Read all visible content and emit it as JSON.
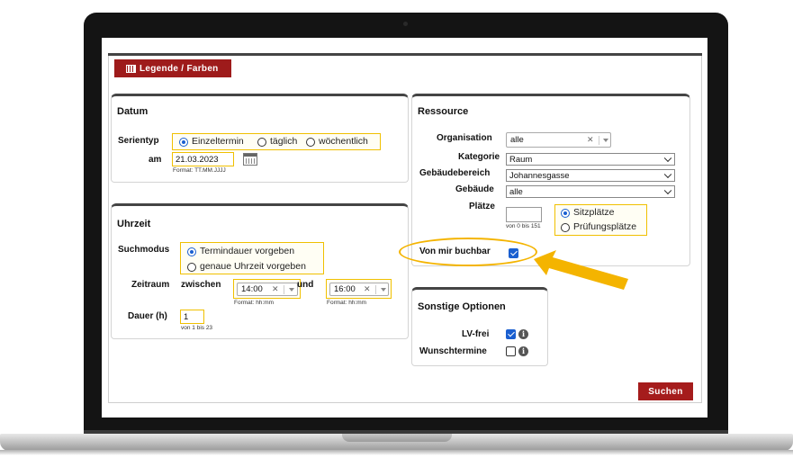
{
  "legend_button": "Legende / Farben",
  "datum": {
    "title": "Datum",
    "serientyp_label": "Serientyp",
    "options": [
      "Einzeltermin",
      "täglich",
      "wöchentlich"
    ],
    "am_label": "am",
    "date_value": "21.03.2023",
    "date_format": "Format: TT.MM.JJJJ"
  },
  "uhrzeit": {
    "title": "Uhrzeit",
    "suchmodus_label": "Suchmodus",
    "modes": [
      "Termindauer vorgeben",
      "genaue Uhrzeit vorgeben"
    ],
    "zeitraum_label": "Zeitraum",
    "zwischen_label": "zwischen",
    "und_label": "und",
    "from_time": "14:00",
    "to_time": "16:00",
    "time_format": "Format: hh:mm",
    "dauer_label": "Dauer (h)",
    "dauer_value": "1",
    "dauer_hint": "von 1 bis 23"
  },
  "ressource": {
    "title": "Ressource",
    "organisation_label": "Organisation",
    "organisation_value": "alle",
    "kategorie_label": "Kategorie",
    "kategorie_value": "Raum",
    "gebaeudebereich_label": "Gebäudebereich",
    "gebaeudebereich_value": "Johannesgasse",
    "gebaeude_label": "Gebäude",
    "gebaeude_value": "alle",
    "plaetze_label": "Plätze",
    "plaetze_hint": "von 0 bis 151",
    "plaetze_options": [
      "Sitzplätze",
      "Prüfungsplätze"
    ],
    "von_mir_buchbar_label": "Von mir buchbar"
  },
  "sonstige": {
    "title": "Sonstige Optionen",
    "lvfrei_label": "LV-frei",
    "wunschtermine_label": "Wunschtermine"
  },
  "search_button": "Suchen",
  "colors": {
    "accent_red": "#a51c1c",
    "highlight_yellow": "#f4b400",
    "checkbox_blue": "#1a5fd0"
  }
}
